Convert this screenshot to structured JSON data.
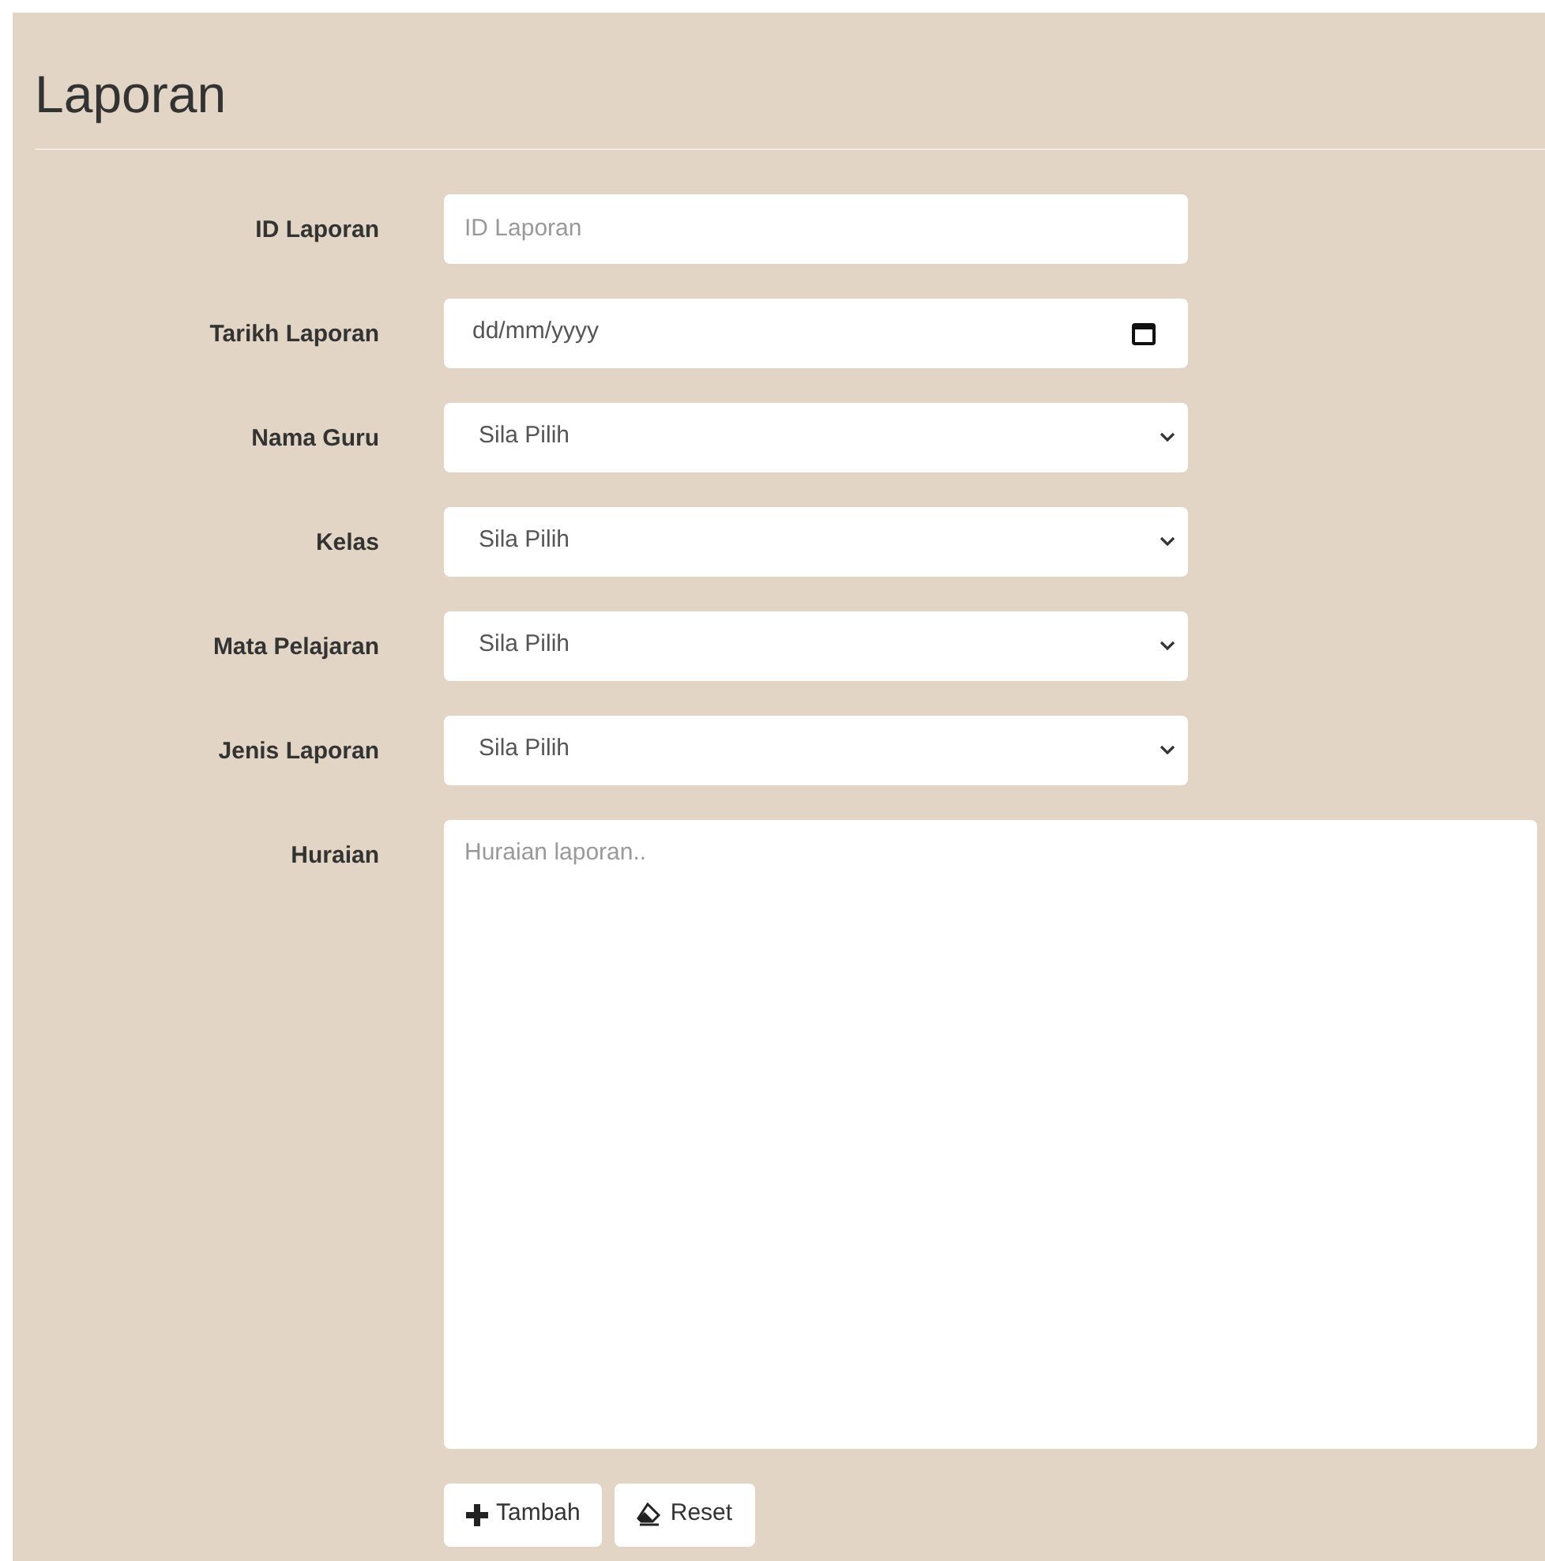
{
  "title": "Laporan",
  "fields": [
    {
      "kind": "text",
      "label": "ID Laporan",
      "placeholder": "ID Laporan"
    },
    {
      "kind": "date",
      "label": "Tarikh Laporan",
      "value": "dd/mm/yyyy"
    },
    {
      "kind": "select",
      "label": "Nama Guru",
      "value": "Sila Pilih"
    },
    {
      "kind": "select",
      "label": "Kelas",
      "value": "Sila Pilih"
    },
    {
      "kind": "select",
      "label": "Mata Pelajaran",
      "value": "Sila Pilih"
    },
    {
      "kind": "select",
      "label": "Jenis Laporan",
      "value": "Sila Pilih"
    },
    {
      "kind": "textarea",
      "label": "Huraian",
      "placeholder": "Huraian laporan.."
    }
  ],
  "buttons": [
    {
      "kind": "add",
      "label": "Tambah"
    },
    {
      "kind": "reset",
      "label": "Reset"
    }
  ]
}
